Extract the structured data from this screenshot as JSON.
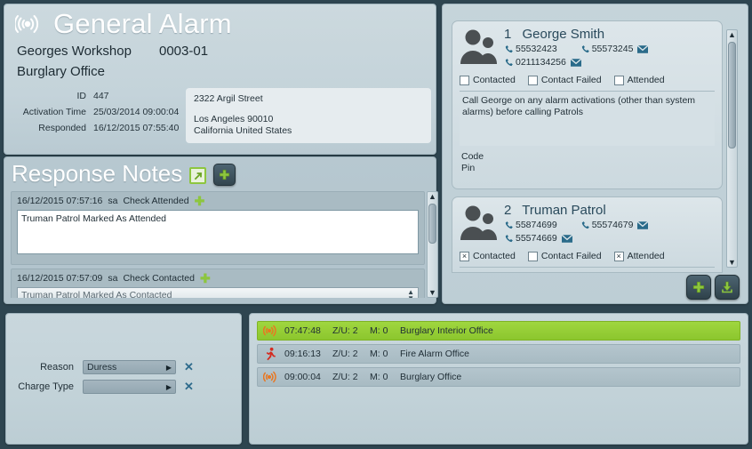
{
  "header": {
    "title": "General Alarm",
    "siren_icon": "siren-wave-icon",
    "site_name": "Georges Workshop",
    "site_code": "0003-01",
    "alarm_type": "Burglary Office",
    "details": [
      {
        "label": "ID",
        "value": "447"
      },
      {
        "label": "Activation Time",
        "value": "25/03/2014 09:00:04"
      },
      {
        "label": "Responded",
        "value": "16/12/2015 07:55:40"
      }
    ],
    "address": {
      "street": "2322 Argil Street",
      "city": "Los Angeles 90010",
      "region": "California United States"
    }
  },
  "notes": {
    "title": "Response Notes",
    "open_icon": "open-external-icon",
    "add_icon": "plus-icon",
    "items": [
      {
        "timestamp": "16/12/2015 07:57:16",
        "user": "sa",
        "action": "Check Attended",
        "add_icon": "plus-icon",
        "kind": "textarea",
        "value": "Truman Patrol Marked As Attended"
      },
      {
        "timestamp": "16/12/2015 07:57:09",
        "user": "sa",
        "action": "Check Contacted",
        "add_icon": "plus-icon",
        "kind": "select",
        "value": "Truman Patrol Marked As Contacted"
      }
    ]
  },
  "contacts": {
    "add_icon": "plus-icon",
    "download_icon": "download-icon",
    "sticky_note": "",
    "cards": [
      {
        "index": "1",
        "name": "George Smith",
        "avatar_icon": "people-icon",
        "phones": [
          {
            "number": "55532423",
            "icon": "phone-icon",
            "has_mail": false
          },
          {
            "number": "55573245",
            "icon": "phone-icon",
            "has_mail": true
          },
          {
            "number": "0211134256",
            "icon": "phone-icon",
            "has_mail": true
          }
        ],
        "checks": [
          {
            "label": "Contacted",
            "checked": false
          },
          {
            "label": "Contact Failed",
            "checked": false
          },
          {
            "label": "Attended",
            "checked": false
          }
        ],
        "note": "Call George on any alarm activations (other than system alarms) before calling Patrols",
        "code_label": "Code",
        "pin_label": "Pin"
      },
      {
        "index": "2",
        "name": "Truman Patrol",
        "avatar_icon": "people-icon",
        "phones": [
          {
            "number": "55874699",
            "icon": "phone-icon",
            "has_mail": false
          },
          {
            "number": "55574679",
            "icon": "phone-icon",
            "has_mail": true
          },
          {
            "number": "55574669",
            "icon": "phone-icon",
            "has_mail": true
          }
        ],
        "checks": [
          {
            "label": "Contacted",
            "checked": true
          },
          {
            "label": "Contact Failed",
            "checked": false
          },
          {
            "label": "Attended",
            "checked": true
          }
        ],
        "note": "",
        "code_label": "",
        "pin_label": ""
      }
    ]
  },
  "reason_form": {
    "rows": [
      {
        "label": "Reason",
        "value": "Duress",
        "clear_icon": "close-icon"
      },
      {
        "label": "Charge Type",
        "value": "",
        "clear_icon": "close-icon"
      }
    ]
  },
  "alarm_list": {
    "rows": [
      {
        "icon": "siren-icon",
        "time": "07:47:48",
        "zu": "Z/U: 2",
        "m": "M: 0",
        "desc": "Burglary Interior Office",
        "selected": true
      },
      {
        "icon": "running-man-icon",
        "time": "09:16:13",
        "zu": "Z/U: 2",
        "m": "M: 0",
        "desc": "Fire Alarm Office",
        "selected": false
      },
      {
        "icon": "siren-icon",
        "time": "09:00:04",
        "zu": "Z/U: 2",
        "m": "M: 0",
        "desc": "Burglary Office",
        "selected": false
      }
    ]
  },
  "colors": {
    "page_bg": "#2e4550",
    "panel_bg": "#c5d4da",
    "accent_green": "#8dc63f",
    "selected_row": "#9fd63f",
    "title_white": "#ffffff",
    "text_dark": "#1f2d35",
    "name_blue": "#2a4a5c",
    "fire_red": "#d42b20",
    "siren_orange": "#e87722",
    "sticky_yellow": "#f5f2d8"
  }
}
